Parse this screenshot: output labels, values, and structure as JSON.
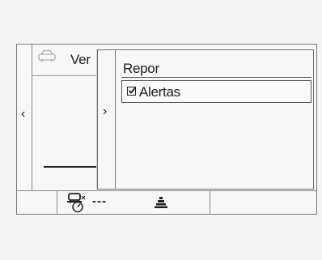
{
  "screen": {
    "background_title": "Ver",
    "car_icon": "car-icon"
  },
  "menu": {
    "title": "Repor",
    "items": [
      {
        "label": "Alertas",
        "checked": true,
        "selected": true
      }
    ]
  },
  "status_bar": {
    "speed_icon": "speed-limiter-icon",
    "speed_value": "---",
    "lane_icon": "lane-assist-icon"
  },
  "colors": {
    "border": "#7a7a7a",
    "background": "#f7f7f7",
    "text": "#222222"
  }
}
